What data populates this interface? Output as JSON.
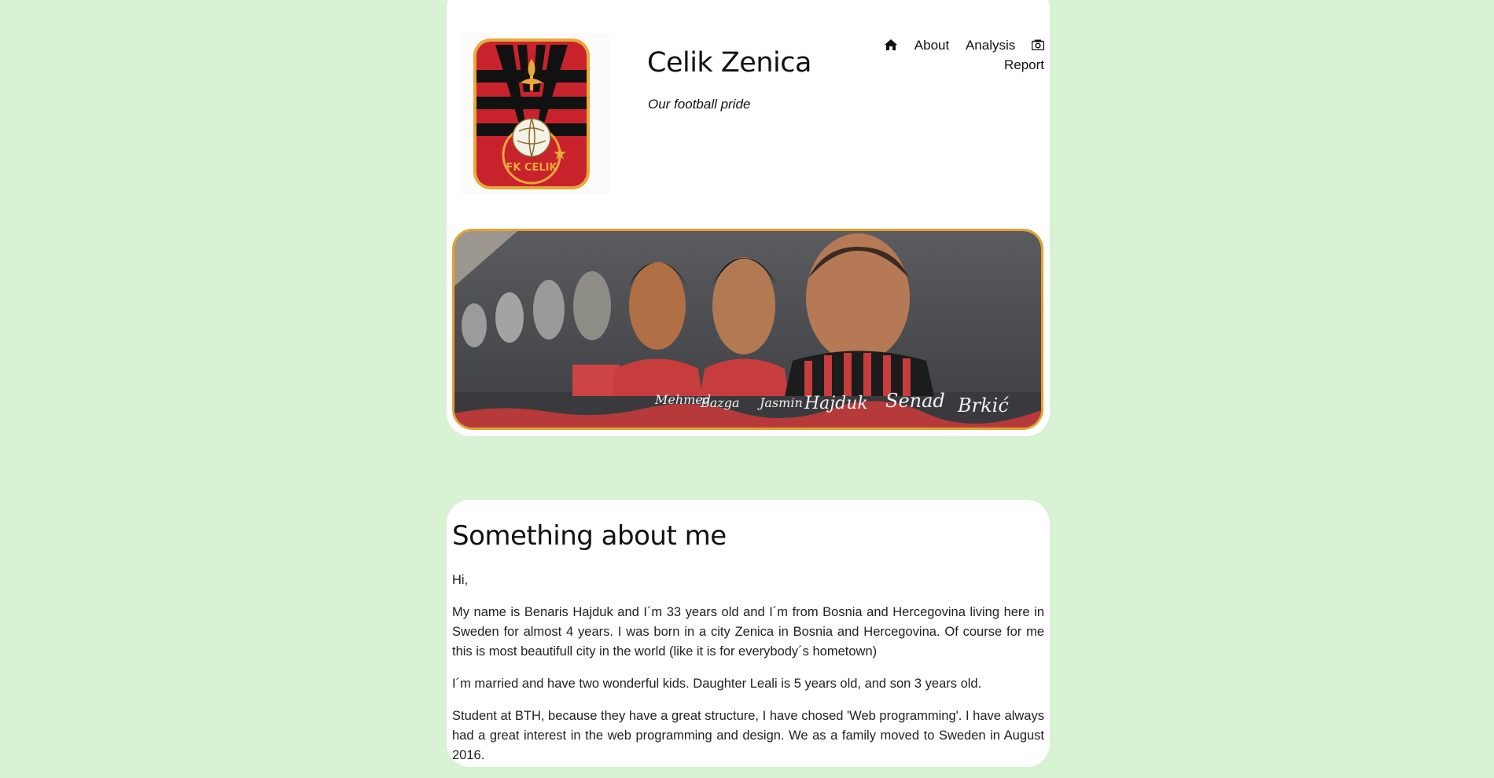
{
  "site": {
    "title": "Celik Zenica",
    "slogan": "Our football pride",
    "logo_text": "FK CELIK"
  },
  "nav": {
    "home_icon": "home-icon",
    "about": "About",
    "analysis": "Analysis",
    "report_icon": "camera-icon",
    "report": "Report"
  },
  "banner": {
    "mural_names": [
      "Mehmed",
      "Bazga",
      "Jasmin",
      "Hajduk",
      "Senad",
      "Brkić"
    ]
  },
  "content": {
    "heading": "Something about me",
    "paragraphs": [
      "Hi,",
      "My name is Benaris Hajduk and I´m 33 years old and I´m from Bosnia and Hercegovina living here in Sweden for almost 4 years. I was born in a city Zenica in Bosnia and Hercegovina. Of course for me this is most beautifull city in the world (like it is for everybody´s hometown)",
      "I´m married and have two wonderful kids. Daughter Leali is 5 years old, and son 3 years old.",
      "Student at BTH, because they have a great structure, I have chosed 'Web programming'. I have always had a great interest in the web programming and design. We as a family moved to Sweden in August 2016."
    ]
  },
  "colors": {
    "page_bg": "#d7f3d3",
    "card_bg": "#ffffff",
    "banner_border": "#e5a130",
    "crest_red": "#c8232c",
    "crest_gold": "#e8a83a"
  }
}
